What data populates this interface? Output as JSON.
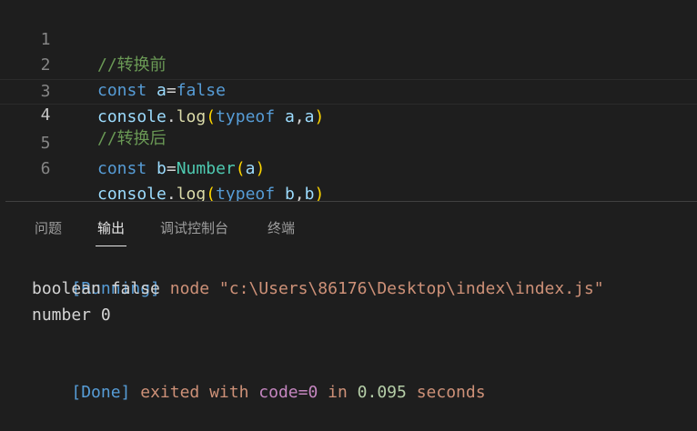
{
  "editor": {
    "lines": [
      {
        "num": "1",
        "tokens": [
          {
            "t": "//转换前",
            "c": "comment"
          }
        ]
      },
      {
        "num": "2",
        "tokens": [
          {
            "t": "const",
            "c": "kw"
          },
          {
            "t": " ",
            "c": "plain"
          },
          {
            "t": "a",
            "c": "var"
          },
          {
            "t": "=",
            "c": "plain"
          },
          {
            "t": "false",
            "c": "kw"
          }
        ]
      },
      {
        "num": "3",
        "tokens": [
          {
            "t": "console",
            "c": "var"
          },
          {
            "t": ".",
            "c": "plain"
          },
          {
            "t": "log",
            "c": "fn"
          },
          {
            "t": "(",
            "c": "paren1"
          },
          {
            "t": "typeof",
            "c": "kw"
          },
          {
            "t": " ",
            "c": "plain"
          },
          {
            "t": "a",
            "c": "var"
          },
          {
            "t": ",",
            "c": "plain"
          },
          {
            "t": "a",
            "c": "var"
          },
          {
            "t": ")",
            "c": "paren1"
          }
        ]
      },
      {
        "num": "4",
        "tokens": [
          {
            "t": "//转换后",
            "c": "comment"
          }
        ]
      },
      {
        "num": "5",
        "tokens": [
          {
            "t": "const",
            "c": "kw"
          },
          {
            "t": " ",
            "c": "plain"
          },
          {
            "t": "b",
            "c": "var"
          },
          {
            "t": "=",
            "c": "plain"
          },
          {
            "t": "Number",
            "c": "type"
          },
          {
            "t": "(",
            "c": "paren1"
          },
          {
            "t": "a",
            "c": "var"
          },
          {
            "t": ")",
            "c": "paren1"
          }
        ]
      },
      {
        "num": "6",
        "tokens": [
          {
            "t": "console",
            "c": "var"
          },
          {
            "t": ".",
            "c": "plain"
          },
          {
            "t": "log",
            "c": "fn"
          },
          {
            "t": "(",
            "c": "paren1"
          },
          {
            "t": "typeof",
            "c": "kw"
          },
          {
            "t": " ",
            "c": "plain"
          },
          {
            "t": "b",
            "c": "var"
          },
          {
            "t": ",",
            "c": "plain"
          },
          {
            "t": "b",
            "c": "var"
          },
          {
            "t": ")",
            "c": "paren1"
          }
        ]
      }
    ],
    "current_line": "4"
  },
  "panel": {
    "tabs": {
      "problems": "问题",
      "output": "输出",
      "debug_console": "调试控制台",
      "terminal": "终端"
    },
    "active_tab": "output",
    "output": {
      "running_tag": "[Running]",
      "running_cmd": " node \"c:\\Users\\86176\\Desktop\\index\\index.js\"",
      "line1": "boolean false",
      "line2": "number 0",
      "done_tag": "[Done]",
      "done_exited": " exited with ",
      "done_code": "code=0",
      "done_in": " in ",
      "done_time": "0.095",
      "done_seconds": " seconds"
    }
  },
  "colors": {
    "background": "#1e1e1e",
    "comment": "#6a9955",
    "keyword": "#569cd6",
    "variable": "#9cdcfe",
    "function": "#dcdcaa",
    "type": "#4ec9b0",
    "bracket": "#ffd700",
    "output_orange": "#ce9178"
  }
}
